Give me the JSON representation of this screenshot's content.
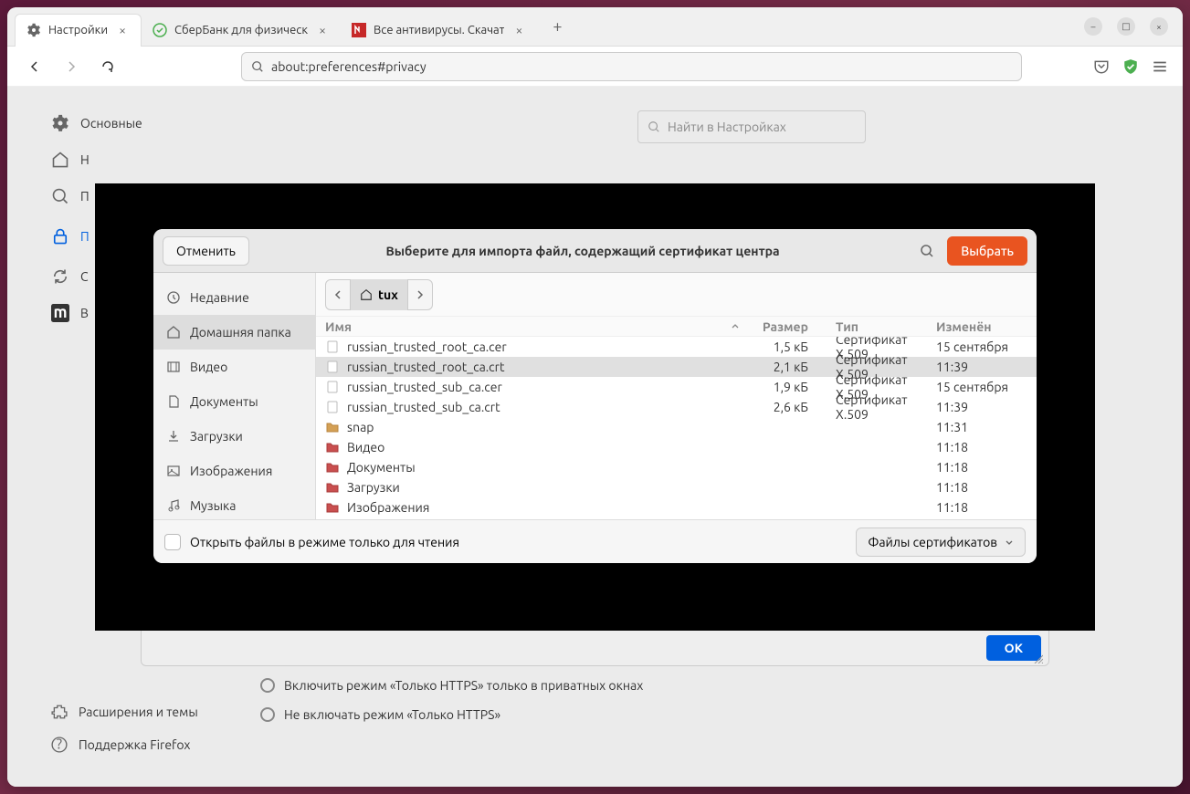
{
  "tabs": [
    {
      "label": "Настройки",
      "icon": "gear"
    },
    {
      "label": "СберБанк для физическ",
      "icon": "check-green"
    },
    {
      "label": "Все антивирусы. Скачат",
      "icon": "red-square"
    }
  ],
  "url": "about:preferences#privacy",
  "settings_search_placeholder": "Найти в Настройках",
  "left_nav": [
    {
      "label": "Основные",
      "icon": "gear"
    },
    {
      "label": "Н",
      "icon": "home"
    },
    {
      "label": "П",
      "icon": "search"
    },
    {
      "label": "П",
      "icon": "lock",
      "active": true
    },
    {
      "label": "С",
      "icon": "sync"
    },
    {
      "label": "В",
      "icon": "m-square"
    }
  ],
  "bottom_nav": [
    {
      "label": "Расширения и темы",
      "icon": "puzzle"
    },
    {
      "label": "Поддержка Firefox",
      "icon": "help"
    }
  ],
  "https_options": [
    "Включить режим «Только HTTPS» только в приватных окнах",
    "Не включать режим «Только HTTPS»"
  ],
  "ok_label": "OK",
  "dialog": {
    "cancel": "Отменить",
    "title": "Выберите для импорта файл, содержащий сертификат центра",
    "select": "Выбрать",
    "breadcrumb": "tux",
    "sidebar": [
      {
        "label": "Недавние",
        "icon": "clock"
      },
      {
        "label": "Домашняя папка",
        "icon": "home",
        "selected": true
      },
      {
        "label": "Видео",
        "icon": "film"
      },
      {
        "label": "Документы",
        "icon": "doc"
      },
      {
        "label": "Загрузки",
        "icon": "download"
      },
      {
        "label": "Изображения",
        "icon": "image"
      },
      {
        "label": "Музыка",
        "icon": "music"
      }
    ],
    "columns": {
      "name": "Имя",
      "size": "Размер",
      "type": "Тип",
      "modified": "Изменён"
    },
    "files": [
      {
        "name": "russian_trusted_root_ca.cer",
        "size": "1,5 кБ",
        "type": "Сертификат X.509",
        "modified": "15 сентября",
        "icon": "file"
      },
      {
        "name": "russian_trusted_root_ca.crt",
        "size": "2,1 кБ",
        "type": "Сертификат X.509",
        "modified": "11:39",
        "icon": "file",
        "selected": true
      },
      {
        "name": "russian_trusted_sub_ca.cer",
        "size": "1,9 кБ",
        "type": "Сертификат X.509",
        "modified": "15 сентября",
        "icon": "file"
      },
      {
        "name": "russian_trusted_sub_ca.crt",
        "size": "2,6 кБ",
        "type": "Сертификат X.509",
        "modified": "11:39",
        "icon": "file"
      },
      {
        "name": "snap",
        "size": "",
        "type": "",
        "modified": "11:31",
        "icon": "folder"
      },
      {
        "name": "Видео",
        "size": "",
        "type": "",
        "modified": "11:18",
        "icon": "folder-media"
      },
      {
        "name": "Документы",
        "size": "",
        "type": "",
        "modified": "11:18",
        "icon": "folder-media"
      },
      {
        "name": "Загрузки",
        "size": "",
        "type": "",
        "modified": "11:18",
        "icon": "folder-media"
      },
      {
        "name": "Изображения",
        "size": "",
        "type": "",
        "modified": "11:18",
        "icon": "folder-media"
      }
    ],
    "readonly_label": "Открыть файлы в режиме только для чтения",
    "filter_label": "Файлы сертификатов"
  }
}
